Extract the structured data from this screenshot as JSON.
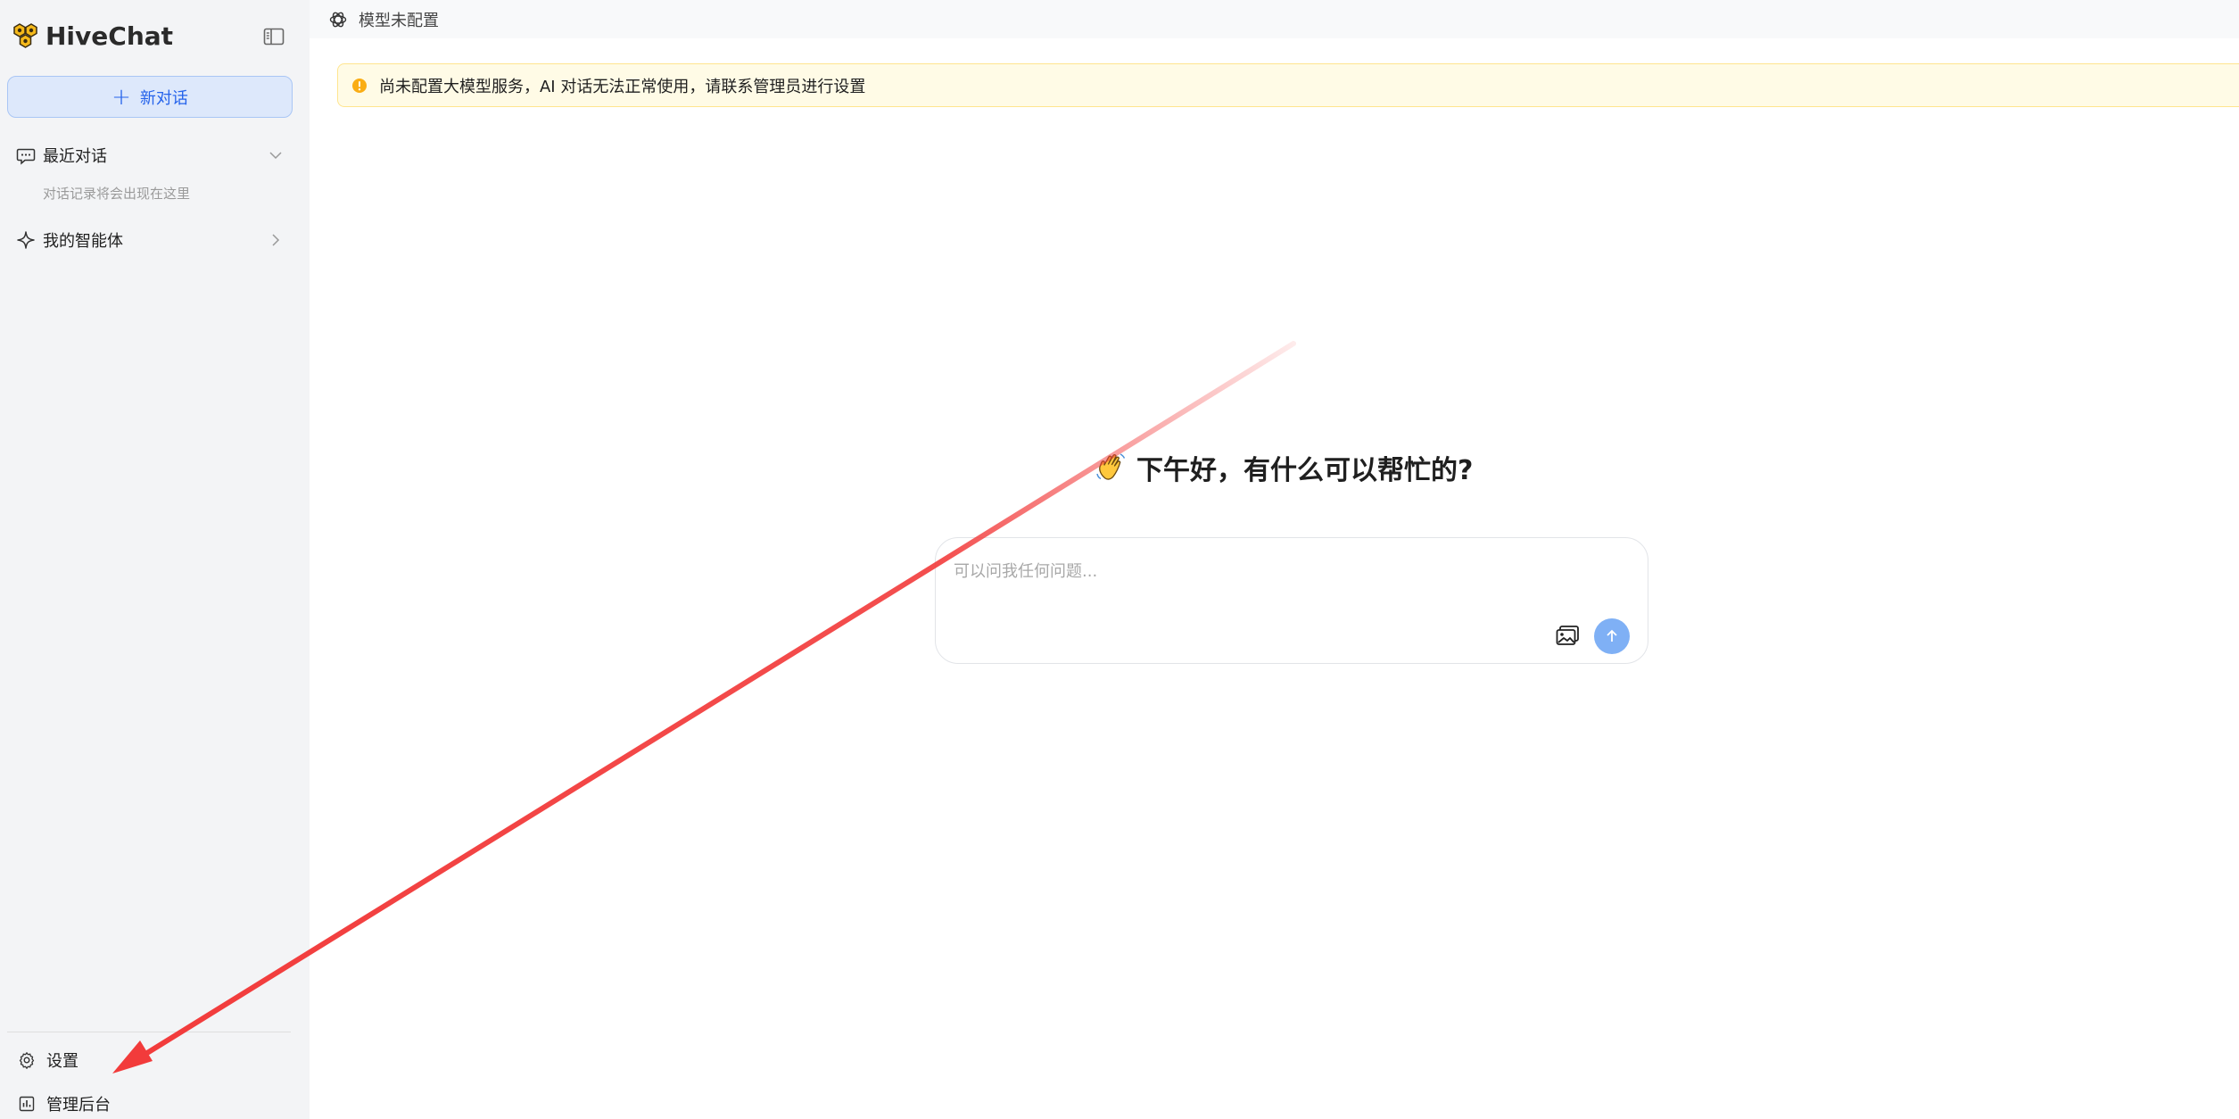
{
  "sidebar": {
    "brand_name": "HiveChat",
    "new_chat_label": "新对话",
    "recent_label": "最近对话",
    "recent_empty_text": "对话记录将会出现在这里",
    "agents_label": "我的智能体",
    "settings_label": "设置",
    "admin_label": "管理后台"
  },
  "topbar": {
    "model_label": "模型未配置"
  },
  "banner": {
    "text": "尚未配置大模型服务，AI 对话无法正常使用，请联系管理员进行设置"
  },
  "main": {
    "greeting": "下午好，有什么可以帮忙的?"
  },
  "chatbox": {
    "placeholder": "可以问我任何问题...",
    "value": ""
  },
  "icons": {
    "brand": "hive-logo-icon",
    "collapse": "sidebar-collapse-icon",
    "recent": "chat-bubble-icon",
    "agents": "sparkle-icon",
    "settings": "gear-icon",
    "admin": "dashboard-icon",
    "model": "openai-icon",
    "warning": "warning-icon",
    "greeting": "waving-hand-icon",
    "image": "image-upload-icon",
    "send": "arrow-up-icon"
  },
  "colors": {
    "accent": "#2563eb",
    "new_chat_bg": "#dde8fb",
    "send_button": "#7fb0f5",
    "warning": "#faad14",
    "banner_bg": "#fffbe6",
    "annotation_arrow": "#f23b3b",
    "sidebar_bg": "#f3f4f6"
  }
}
